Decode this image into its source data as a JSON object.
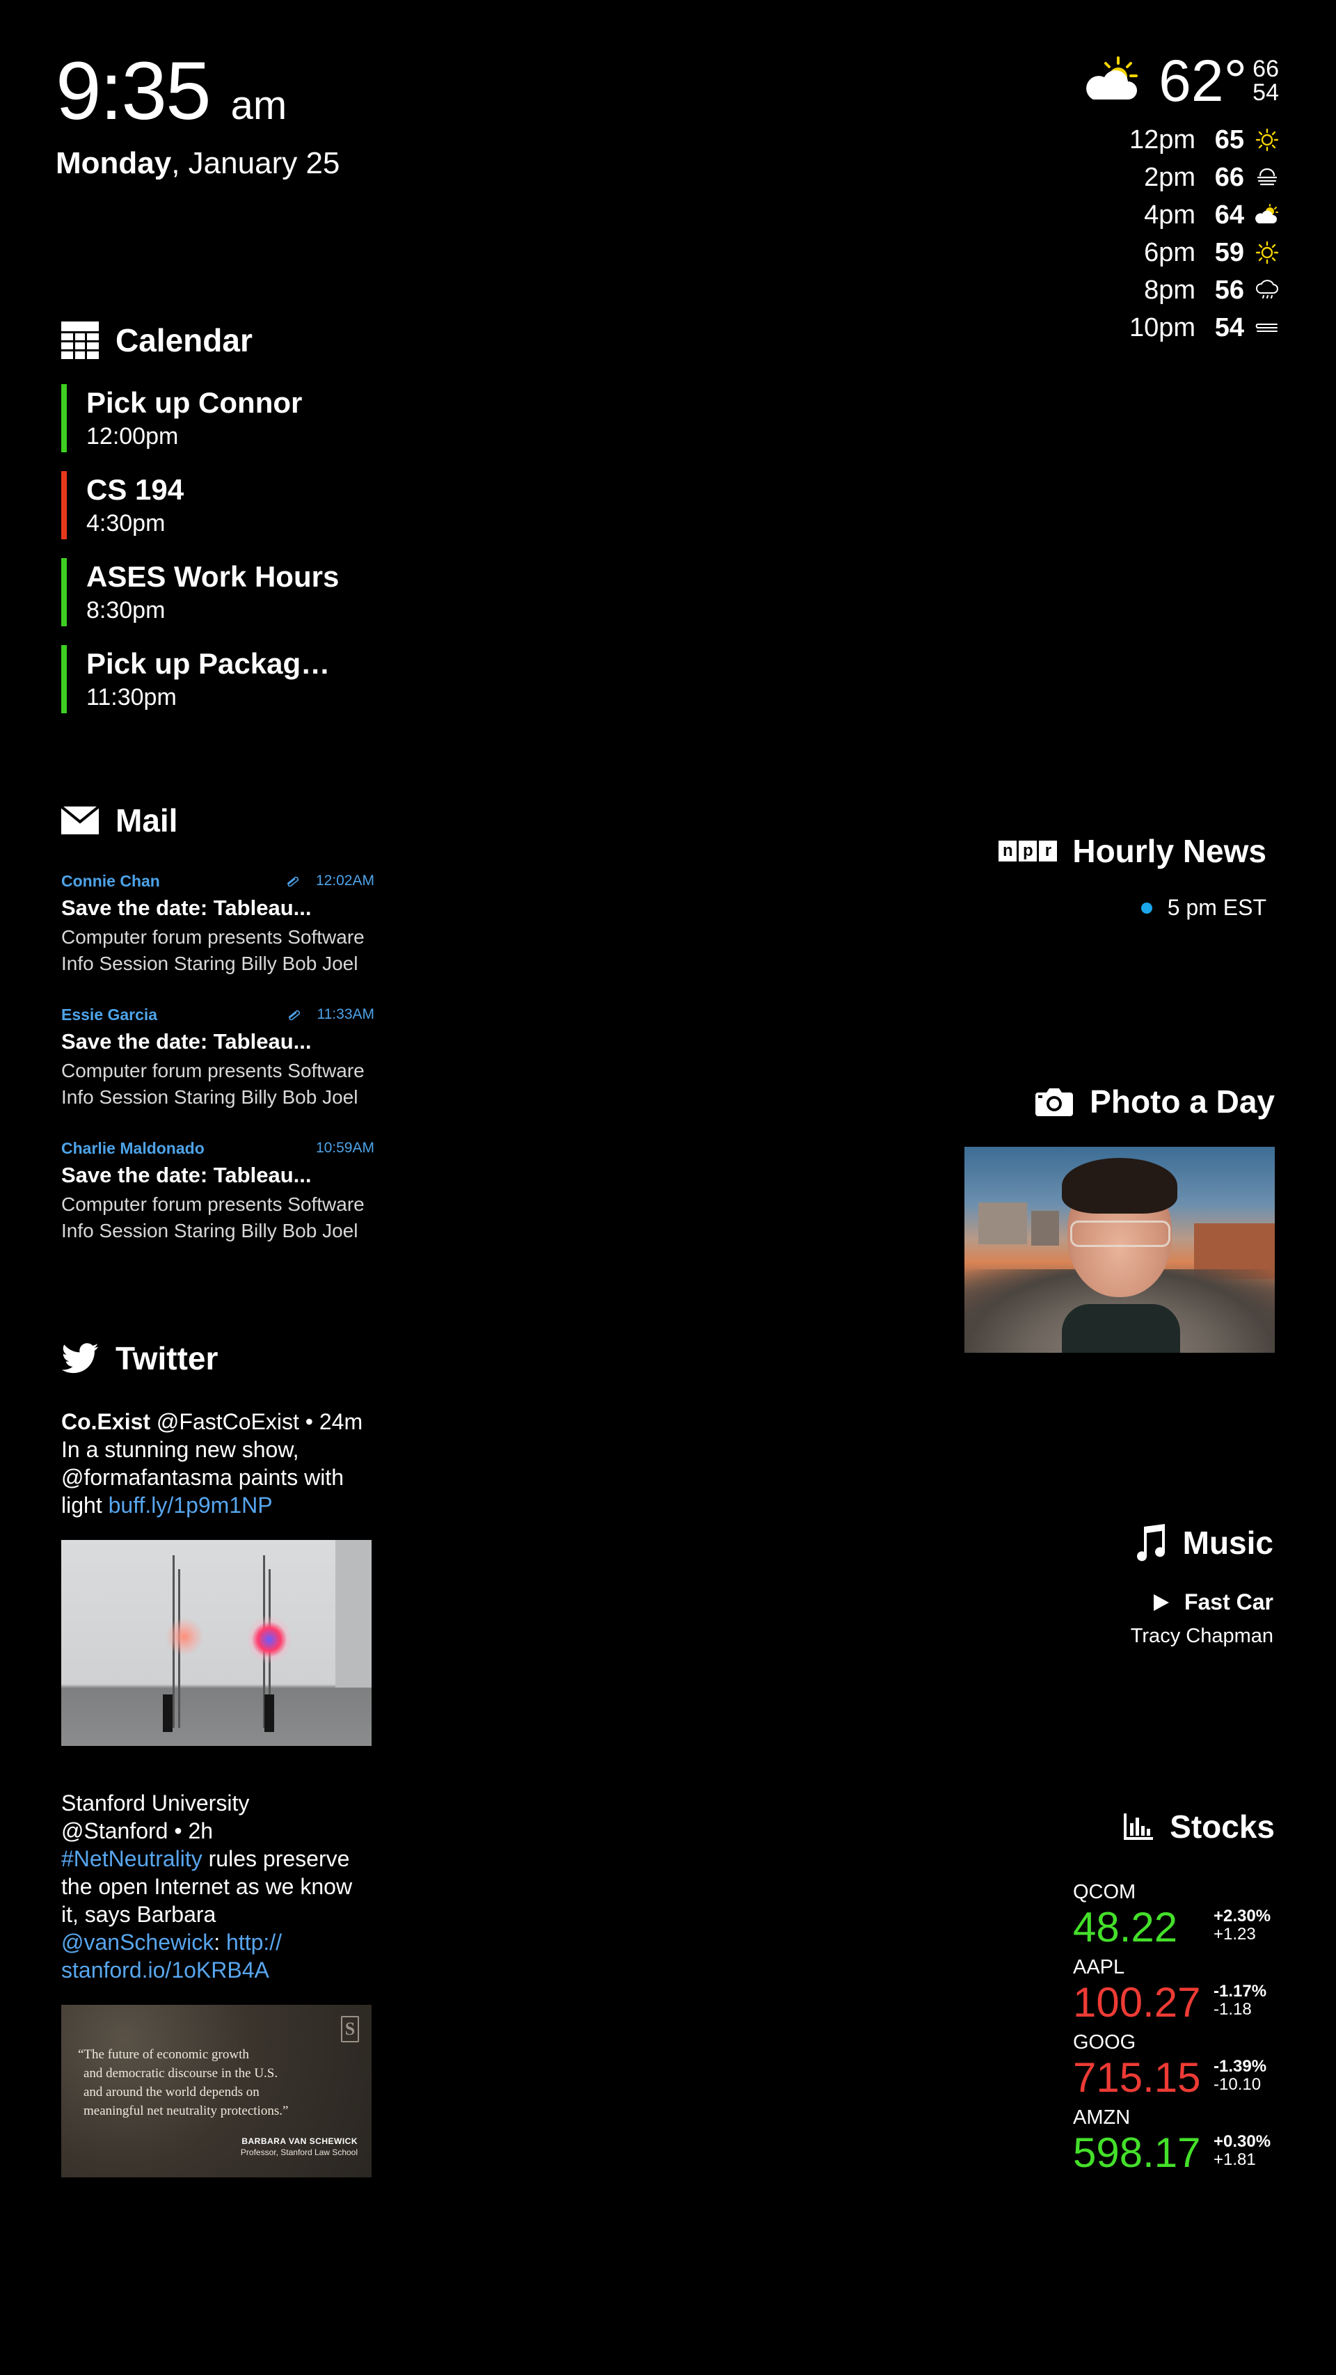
{
  "clock": {
    "time": "9:35",
    "ampm": "am",
    "day": "Monday",
    "date": ", January 25"
  },
  "weather": {
    "current_temp": "62°",
    "high": "66",
    "low": "54",
    "current_icon": "partly-sunny-icon",
    "forecast": [
      {
        "time": "12pm",
        "temp": "65",
        "icon": "sun-icon"
      },
      {
        "time": "2pm",
        "temp": "66",
        "icon": "fog-icon"
      },
      {
        "time": "4pm",
        "temp": "64",
        "icon": "partly-cloudy-icon"
      },
      {
        "time": "6pm",
        "temp": "59",
        "icon": "sun-icon"
      },
      {
        "time": "8pm",
        "temp": "56",
        "icon": "rain-icon"
      },
      {
        "time": "10pm",
        "temp": "54",
        "icon": "wind-icon"
      }
    ],
    "colors": {
      "sun": "#f5d400"
    }
  },
  "calendar": {
    "title": "Calendar",
    "events": [
      {
        "title": "Pick up Connor",
        "time": "12:00pm",
        "color": "#3ecf22"
      },
      {
        "title": "CS 194",
        "time": "4:30pm",
        "color": "#e8381b"
      },
      {
        "title": "ASES Work Hours",
        "time": "8:30pm",
        "color": "#3ecf22"
      },
      {
        "title": "Pick up Packag…",
        "time": "11:30pm",
        "color": "#3ecf22"
      }
    ]
  },
  "mail": {
    "title": "Mail",
    "messages": [
      {
        "from": "Connie Chan",
        "time": "12:02AM",
        "attachment": true,
        "subject": "Save the date: Tableau...",
        "line1": "Computer forum presents Software",
        "line2": "Info Session Staring Billy Bob Joel"
      },
      {
        "from": "Essie Garcia",
        "time": "11:33AM",
        "attachment": true,
        "subject": "Save the date: Tableau...",
        "line1": "Computer forum presents Software",
        "line2": "Info Session Staring Billy Bob Joel"
      },
      {
        "from": "Charlie Maldonado",
        "time": "10:59AM",
        "attachment": false,
        "subject": "Save the date: Tableau...",
        "line1": "Computer forum presents Software",
        "line2": "Info Session Staring Billy Bob Joel"
      }
    ]
  },
  "twitter": {
    "title": "Twitter",
    "tweet1": {
      "author": "Co.Exist",
      "handle_meta": " @FastCoExist • 24m",
      "line1": "In a stunning new show,",
      "line2": "@formafantasma paints with",
      "line3_prefix": "light ",
      "link": "buff.ly/1p9m1NP"
    },
    "tweet2": {
      "author": "Stanford University",
      "handle_meta": "@Stanford • 2h",
      "hashtag": "#NetNeutrality",
      "after_hashtag": " rules preserve",
      "line3": "the open Internet as we know",
      "line4": "it, says Barbara",
      "mention": "@vanSchewick",
      "colon": ": ",
      "link_a": "http://",
      "link_b": "stanford.io/1oKRB4A",
      "quote": {
        "logo": "S",
        "l1": "“The future of economic growth",
        "l2": "and democratic discourse in the U.S.",
        "l3": "and around the world depends on",
        "l4": "meaningful net neutrality protections.”",
        "name": "BARBARA VAN SCHEWICK",
        "role": "Professor, Stanford Law School"
      }
    }
  },
  "news": {
    "logo_letters": [
      "n",
      "p",
      "r"
    ],
    "title": "Hourly News",
    "item": "5 pm EST"
  },
  "photo": {
    "title": "Photo a Day"
  },
  "music": {
    "title": "Music",
    "song": "Fast Car",
    "artist": "Tracy Chapman"
  },
  "stocks": {
    "title": "Stocks",
    "items": [
      {
        "symbol": "QCOM",
        "price": "48.22",
        "pct": "+2.30%",
        "chg": "+1.23",
        "dir": "up"
      },
      {
        "symbol": "AAPL",
        "price": "100.27",
        "pct": "-1.17%",
        "chg": "-1.18",
        "dir": "down"
      },
      {
        "symbol": "GOOG",
        "price": "715.15",
        "pct": "-1.39%",
        "chg": "-10.10",
        "dir": "down"
      },
      {
        "symbol": "AMZN",
        "price": "598.17",
        "pct": "+0.30%",
        "chg": "+1.81",
        "dir": "up"
      }
    ],
    "colors": {
      "up": "#44e02a",
      "down": "#ee3b35"
    }
  }
}
